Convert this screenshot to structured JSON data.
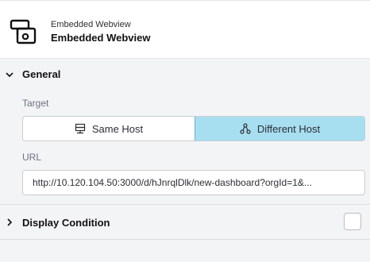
{
  "header": {
    "subtitle": "Embedded Webview",
    "title": "Embedded Webview",
    "icon": "webview-icon"
  },
  "general": {
    "title": "General",
    "target_label": "Target",
    "target_options": [
      {
        "label": "Same Host",
        "icon": "server-icon"
      },
      {
        "label": "Different Host",
        "icon": "network-icon"
      }
    ],
    "selected_target": "Different Host",
    "url_label": "URL",
    "url_value": "http://10.120.104.50:3000/d/hJnrqlDlk/new-dashboard?orgId=1&..."
  },
  "display_condition": {
    "title": "Display Condition",
    "checked": false
  },
  "colors": {
    "selected_bg": "#a7def0",
    "selected_border": "#62b8d8",
    "panel_bg": "#f3f4f6"
  }
}
